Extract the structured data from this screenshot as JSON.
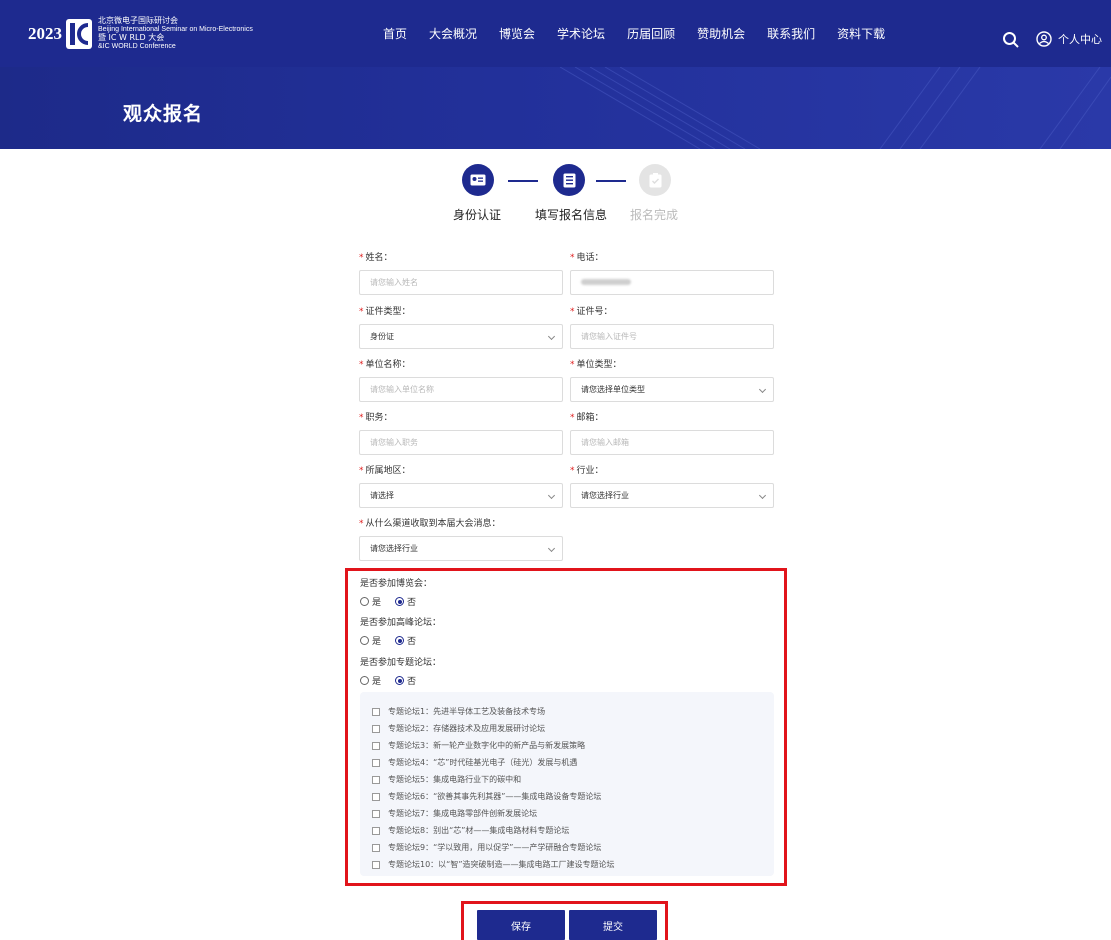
{
  "header": {
    "year": "2023",
    "logo_cn": "北京微电子国际研讨会",
    "logo_en": "Beijing International Seminar on Micro-Electronics",
    "logo_cn2": "暨 IC W RLD 大会",
    "logo_en2": "&IC WORLD Conference",
    "nav": [
      "首页",
      "大会概况",
      "博览会",
      "学术论坛",
      "历届回顾",
      "赞助机会",
      "联系我们",
      "资料下载"
    ],
    "user_label": "个人中心"
  },
  "banner": {
    "title": "观众报名"
  },
  "steps": [
    {
      "label": "身份认证",
      "state": "done"
    },
    {
      "label": "填写报名信息",
      "state": "active"
    },
    {
      "label": "报名完成",
      "state": "pending"
    }
  ],
  "form": {
    "name": {
      "label": "姓名：",
      "placeholder": "请您输入姓名"
    },
    "phone": {
      "label": "电话：",
      "value": ""
    },
    "id_type": {
      "label": "证件类型：",
      "value": "身份证"
    },
    "id_number": {
      "label": "证件号：",
      "placeholder": "请您输入证件号"
    },
    "org_name": {
      "label": "单位名称：",
      "placeholder": "请您输入单位名称"
    },
    "org_type": {
      "label": "单位类型：",
      "placeholder": "请您选择单位类型"
    },
    "position": {
      "label": "职务：",
      "placeholder": "请您输入职务"
    },
    "email": {
      "label": "邮箱：",
      "placeholder": "请您输入邮箱"
    },
    "region": {
      "label": "所属地区：",
      "placeholder": "请选择"
    },
    "industry": {
      "label": "行业：",
      "placeholder": "请您选择行业"
    },
    "channel": {
      "label": "从什么渠道收取到本届大会消息：",
      "placeholder": "请您选择行业"
    }
  },
  "questions": [
    {
      "label": "是否参加博览会：",
      "yes": "是",
      "no": "否",
      "selected": "否"
    },
    {
      "label": "是否参加高峰论坛：",
      "yes": "是",
      "no": "否",
      "selected": "否"
    },
    {
      "label": "是否参加专题论坛：",
      "yes": "是",
      "no": "否",
      "selected": "否"
    }
  ],
  "forums": [
    "专题论坛1：先进半导体工艺及装备技术专场",
    "专题论坛2：存储器技术及应用发展研讨论坛",
    "专题论坛3：新一轮产业数字化中的新产品与新发展策略",
    "专题论坛4：“芯”时代硅基光电子（硅光）发展与机遇",
    "专题论坛5：集成电路行业下的碳中和",
    "专题论坛6：“欲善其事先利其器”——集成电路设备专题论坛",
    "专题论坛7：集成电路零部件创新发展论坛",
    "专题论坛8：别出“芯”材——集成电路材料专题论坛",
    "专题论坛9：“学以致用，用以促学”——产学研融合专题论坛",
    "专题论坛10：以“智”造突破制造——集成电路工厂建设专题论坛"
  ],
  "buttons": {
    "save": "保存",
    "submit": "提交"
  },
  "colors": {
    "primary": "#1e2a8f",
    "highlight": "#e1141b",
    "required": "#e02020"
  }
}
